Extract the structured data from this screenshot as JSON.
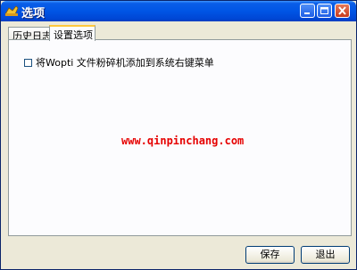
{
  "window": {
    "title": "选项",
    "accent_color": "#0055e5"
  },
  "title_buttons": {
    "minimize": "minimize-icon",
    "maximize": "maximize-icon",
    "close": "close-icon"
  },
  "tabs": [
    {
      "label": "历史日志",
      "active": false
    },
    {
      "label": "设置选项",
      "active": true
    }
  ],
  "settings": {
    "add_context_menu": {
      "label": "将Wopti 文件粉碎机添加到系统右键菜单",
      "checked": false
    }
  },
  "watermark": {
    "text": "www.qinpinchang.com",
    "color": "#e60000"
  },
  "buttons": {
    "save": "保存",
    "exit": "退出"
  }
}
